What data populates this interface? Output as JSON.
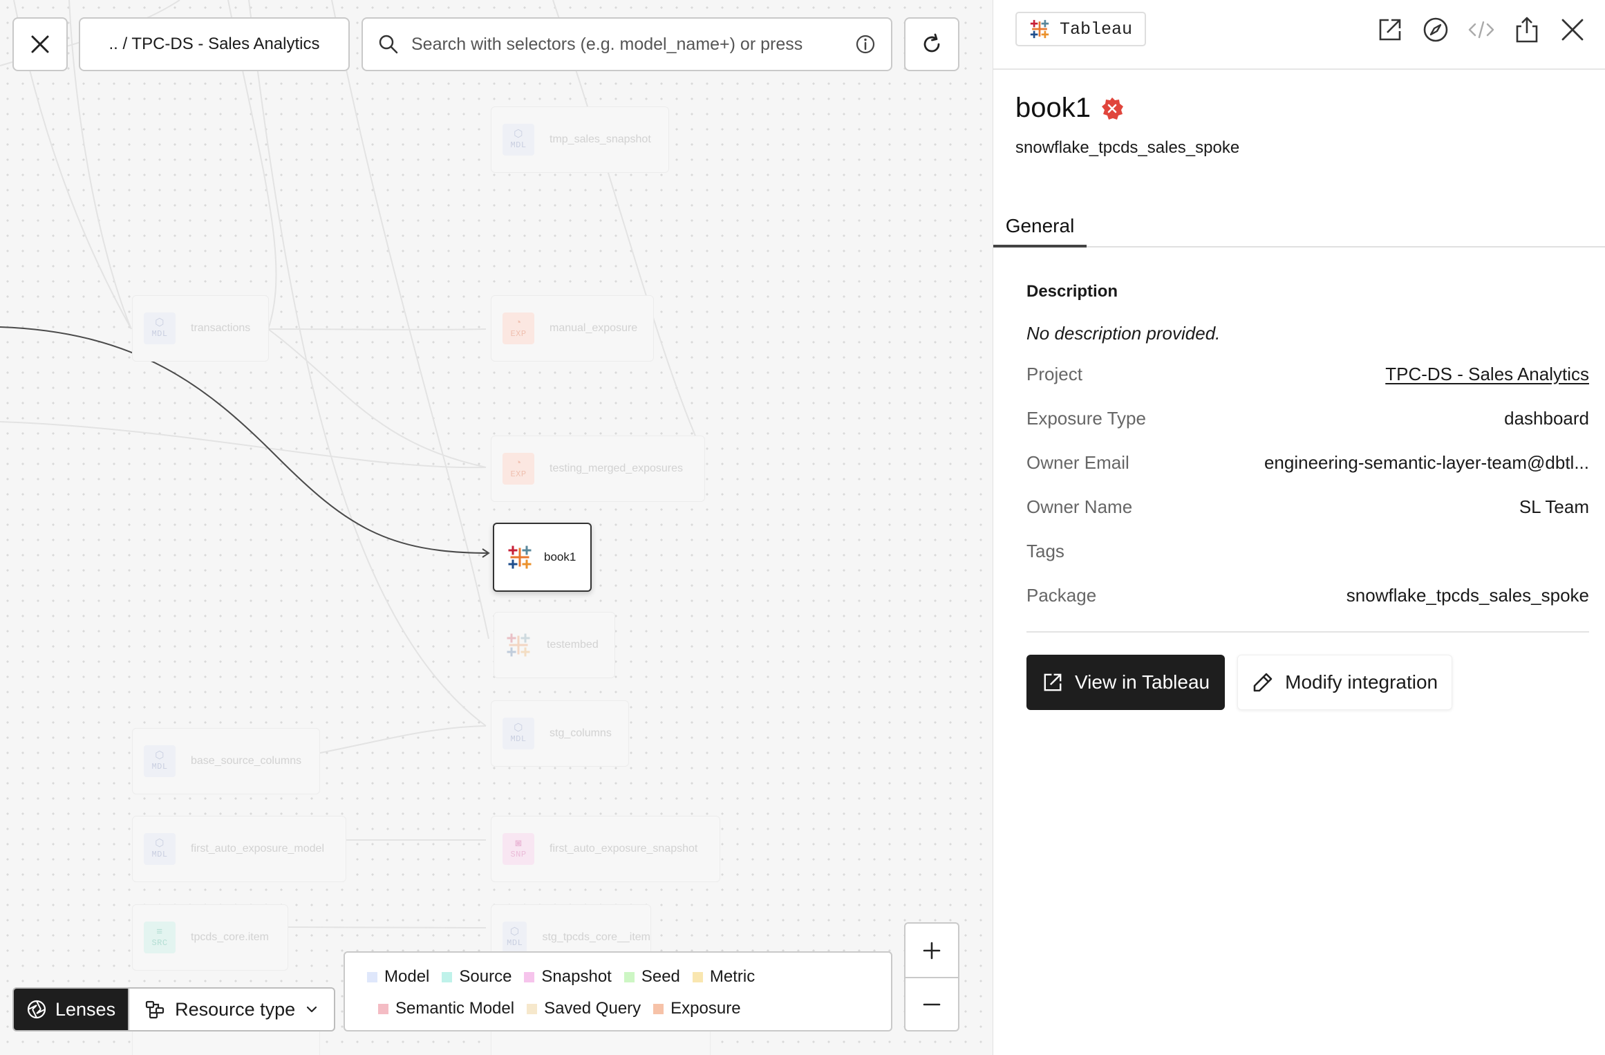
{
  "toolbar": {
    "breadcrumb": ".. / TPC-DS - Sales Analytics",
    "search_placeholder": "Search with selectors (e.g. model_name+) or press"
  },
  "nodes": [
    {
      "label": "tmp_sales_snapshot",
      "badge": "MDL",
      "kind": "model"
    },
    {
      "label": "transactions",
      "badge": "MDL",
      "kind": "model"
    },
    {
      "label": "manual_exposure",
      "badge": "EXP",
      "kind": "exposure"
    },
    {
      "label": "testing_merged_exposures",
      "badge": "EXP",
      "kind": "exposure"
    },
    {
      "label": "book1",
      "badge": "",
      "kind": "tableau",
      "active": true
    },
    {
      "label": "testembed",
      "badge": "",
      "kind": "tableau"
    },
    {
      "label": "stg_columns",
      "badge": "MDL",
      "kind": "model"
    },
    {
      "label": "base_source_columns",
      "badge": "MDL",
      "kind": "model"
    },
    {
      "label": "first_auto_exposure_model",
      "badge": "MDL",
      "kind": "model"
    },
    {
      "label": "first_auto_exposure_snapshot",
      "badge": "SNP",
      "kind": "snapshot"
    },
    {
      "label": "tpcds_core.item",
      "badge": "SRC",
      "kind": "source"
    },
    {
      "label": "stg_tpcds_core__item",
      "badge": "MDL",
      "kind": "model"
    }
  ],
  "bottom": {
    "lenses_label": "Lenses",
    "resource_type_label": "Resource type"
  },
  "legend": [
    {
      "label": "Model",
      "color": "#dfe7fb"
    },
    {
      "label": "Source",
      "color": "#bff2ea"
    },
    {
      "label": "Snapshot",
      "color": "#f6c4ec"
    },
    {
      "label": "Seed",
      "color": "#cdf6c4"
    },
    {
      "label": "Metric",
      "color": "#f9e6b0"
    },
    {
      "label": "Semantic Model",
      "color": "#f4bcc4"
    },
    {
      "label": "Saved Query",
      "color": "#f6e8cc"
    },
    {
      "label": "Exposure",
      "color": "#f6c2a8"
    }
  ],
  "panel": {
    "tool_chip": "Tableau",
    "title": "book1",
    "subtitle": "snowflake_tpcds_sales_spoke",
    "tab": "General",
    "description_label": "Description",
    "description_text": "No description provided.",
    "properties": [
      {
        "key": "Project",
        "value": "TPC-DS - Sales Analytics"
      },
      {
        "key": "Exposure Type",
        "value": "dashboard"
      },
      {
        "key": "Owner Email",
        "value": "engineering-semantic-layer-team@dbtl..."
      },
      {
        "key": "Owner Name",
        "value": "SL Team"
      },
      {
        "key": "Tags",
        "value": ""
      },
      {
        "key": "Package",
        "value": "snowflake_tpcds_sales_spoke"
      }
    ],
    "view_button": "View in Tableau",
    "modify_button": "Modify integration"
  },
  "colors": {
    "error": "#e0453c",
    "dark_button": "#1e1e1e",
    "tableau_blue": "#1f4e8c",
    "tableau_orange": "#e8762d",
    "tableau_red": "#c72037",
    "tableau_teal": "#59879b"
  }
}
